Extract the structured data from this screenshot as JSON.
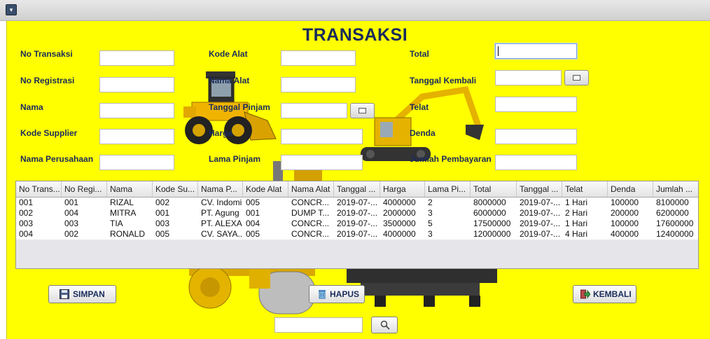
{
  "window": {
    "menu_icon": "chevron-down-icon"
  },
  "form": {
    "title": "TRANSAKSI",
    "labels": {
      "no_transaksi": "No Transaksi",
      "no_registrasi": "No Registrasi",
      "nama": "Nama",
      "kode_supplier": "Kode Supplier",
      "nama_perusahaan": "Nama Perusahaan",
      "kode_alat": "Kode Alat",
      "nama_alat": "Nama Alat",
      "tanggal_pinjam": "Tanggal Pinjam",
      "harga": "Harga",
      "lama_pinjam": "Lama Pinjam",
      "total": "Total",
      "tanggal_kembali": "Tanggal Kembali",
      "telat": "Telat",
      "denda": "Denda",
      "jumlah_pembayaran": "Jumlah Pembayaran"
    }
  },
  "table": {
    "columns": [
      "No Trans...",
      "No Regi...",
      "Nama",
      "Kode Su...",
      "Nama P...",
      "Kode Alat",
      "Nama Alat",
      "Tanggal ...",
      "Harga",
      "Lama Pi...",
      "Total",
      "Tanggal ...",
      "Telat",
      "Denda",
      "Jumlah ..."
    ],
    "rows": [
      [
        "001",
        "001",
        "RIZAL",
        "002",
        "CV. Indomi",
        "005",
        "CONCR...",
        "2019-07-...",
        "4000000",
        "2",
        "8000000",
        "2019-07-...",
        "1 Hari",
        "100000",
        "8100000"
      ],
      [
        "002",
        "004",
        "MITRA",
        "001",
        "PT. Agung",
        "001",
        "DUMP T...",
        "2019-07-...",
        "2000000",
        "3",
        "6000000",
        "2019-07-...",
        "2 Hari",
        "200000",
        "6200000"
      ],
      [
        "003",
        "003",
        "TIA",
        "003",
        "PT. ALEXA",
        "004",
        "CONCR...",
        "2019-07-...",
        "3500000",
        "5",
        "17500000",
        "2019-07-...",
        "1 Hari",
        "100000",
        "17600000"
      ],
      [
        "004",
        "002",
        "RONALD",
        "005",
        "CV. SAYA...",
        "005",
        "CONCR...",
        "2019-07-...",
        "4000000",
        "3",
        "12000000",
        "2019-07-...",
        "4 Hari",
        "400000",
        "12400000"
      ]
    ]
  },
  "buttons": {
    "simpan": "SIMPAN",
    "hapus": "HAPUS",
    "kembali": "KEMBALI"
  },
  "icons": {
    "calendar": "calendar-icon",
    "save": "floppy-disk-icon",
    "delete": "trash-icon",
    "back": "exit-arrow-icon",
    "search": "search-icon"
  },
  "colors": {
    "background": "#ffff00",
    "label": "#1a2b5c"
  }
}
